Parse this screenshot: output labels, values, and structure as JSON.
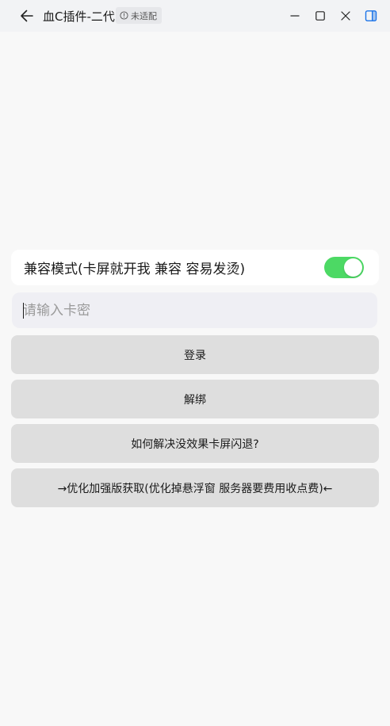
{
  "titlebar": {
    "title": "血C插件-二代",
    "badge": "未适配",
    "icons": [
      "back-arrow-icon",
      "info-icon",
      "minimize-icon",
      "maximize-icon",
      "close-icon",
      "sidebar-toggle-icon"
    ]
  },
  "settings": {
    "compat_label": "兼容模式(卡屏就开我 兼容 容易发烫)",
    "compat_enabled": true
  },
  "card_key_input": {
    "placeholder": "请输入卡密",
    "value": ""
  },
  "buttons": {
    "login": "登录",
    "unbind": "解绑",
    "help": "如何解决没效果卡屏闪退?",
    "enhanced": "→优化加强版获取(优化掉悬浮窗 服务器要费用收点费)←"
  },
  "colors": {
    "toggle_on": "#4cd964",
    "accent": "#1a73e8"
  }
}
